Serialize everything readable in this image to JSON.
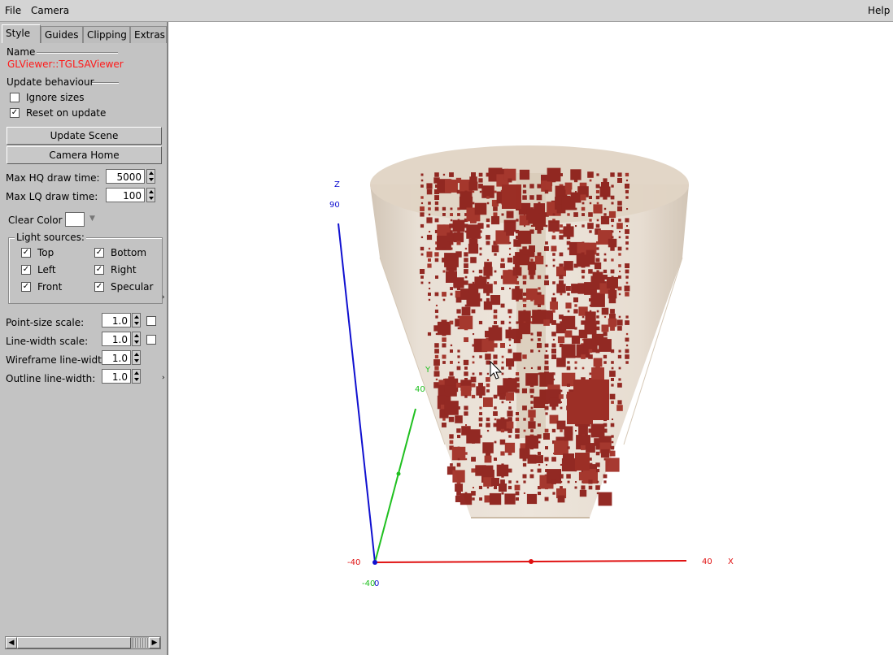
{
  "menubar": {
    "file": "File",
    "camera": "Camera",
    "help": "Help"
  },
  "tabs": [
    {
      "label": "Style",
      "active": true
    },
    {
      "label": "Guides",
      "active": false
    },
    {
      "label": "Clipping",
      "active": false
    },
    {
      "label": "Extras",
      "active": false
    }
  ],
  "style": {
    "name_section": "Name",
    "viewer_name": "GLViewer::TGLSAViewer",
    "update_section": "Update behaviour",
    "ignore_sizes": {
      "label": "Ignore sizes",
      "checked": false
    },
    "reset_on_update": {
      "label": "Reset on update",
      "checked": true
    },
    "update_scene_button": "Update Scene",
    "camera_home_button": "Camera Home",
    "max_hq_label": "Max HQ draw time:",
    "max_hq_value": "5000",
    "max_lq_label": "Max LQ draw time:",
    "max_lq_value": "100",
    "clear_color_label": "Clear Color",
    "light_sources_title": "Light sources:",
    "lights": {
      "top": "Top",
      "bottom": "Bottom",
      "left": "Left",
      "right": "Right",
      "front": "Front",
      "specular": "Specular"
    },
    "point_size_label": "Point-size scale:",
    "point_size_value": "1.0",
    "line_width_label": "Line-width scale:",
    "line_width_value": "1.0",
    "wireframe_label": "Wireframe line-width:",
    "wireframe_value": "1.0",
    "outline_label": "Outline line-width:",
    "outline_value": "1.0"
  },
  "viewport": {
    "axes": {
      "z_name": "Z",
      "z_max": "90",
      "y_name": "Y",
      "y_max": "40",
      "y_min": "-40",
      "x_name": "X",
      "x_max": "40",
      "x_min": "-40",
      "origin": "0",
      "x_color": "#ff0000",
      "y_color": "#00cc00",
      "z_color": "#0000cc"
    },
    "colors": {
      "cone": "#d8ccbc",
      "blocks": "#8b1a14"
    }
  }
}
